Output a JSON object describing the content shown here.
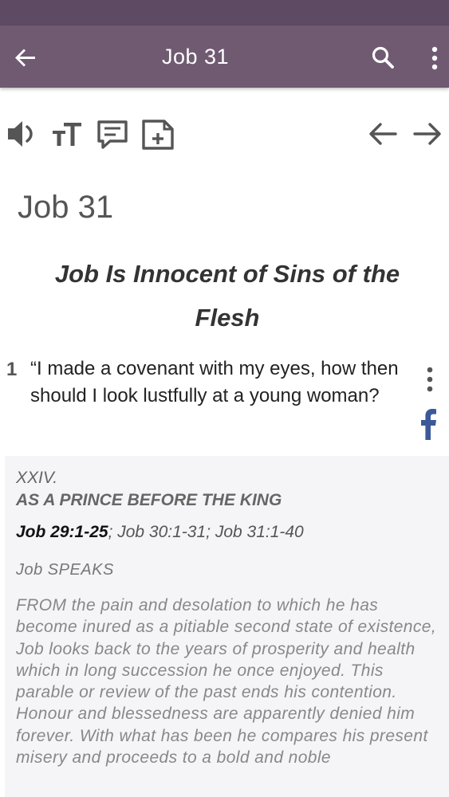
{
  "app_bar": {
    "title": "Job 31",
    "background": "#705a72",
    "icons": [
      "back-arrow-icon",
      "search-icon",
      "more-vert-icon"
    ]
  },
  "toolbar": {
    "icons": [
      "speaker-icon",
      "text-size-icon",
      "comment-icon",
      "add-note-icon",
      "arrow-left-icon",
      "arrow-right-icon"
    ]
  },
  "chapter": {
    "title": "Job 31",
    "section_heading": "Job Is Innocent of Sins of the Flesh"
  },
  "verse": {
    "number": "1",
    "text": "“I made a covenant with my eyes, how then should I look lustfully at a young woman?",
    "icons": [
      "more-vert-icon",
      "facebook-icon"
    ],
    "facebook_color": "#3b5998"
  },
  "commentary": {
    "heading_line1": "XXIV.",
    "heading_line2": "AS A PRINCE BEFORE THE KING",
    "ref_primary": "Job 29:1-25",
    "ref_rest": "; Job 30:1-31; Job 31:1-40",
    "speaker": "Job SPEAKS",
    "body": "FROM the pain and desolation to which he has become inured as a pitiable second state of existence, Job looks back to the years of prosperity and health which in long succession he once enjoyed. This parable or review of the past ends his contention. Honour and blessedness are apparently denied him forever. With what has been he compares his present misery and proceeds to a bold and noble"
  }
}
